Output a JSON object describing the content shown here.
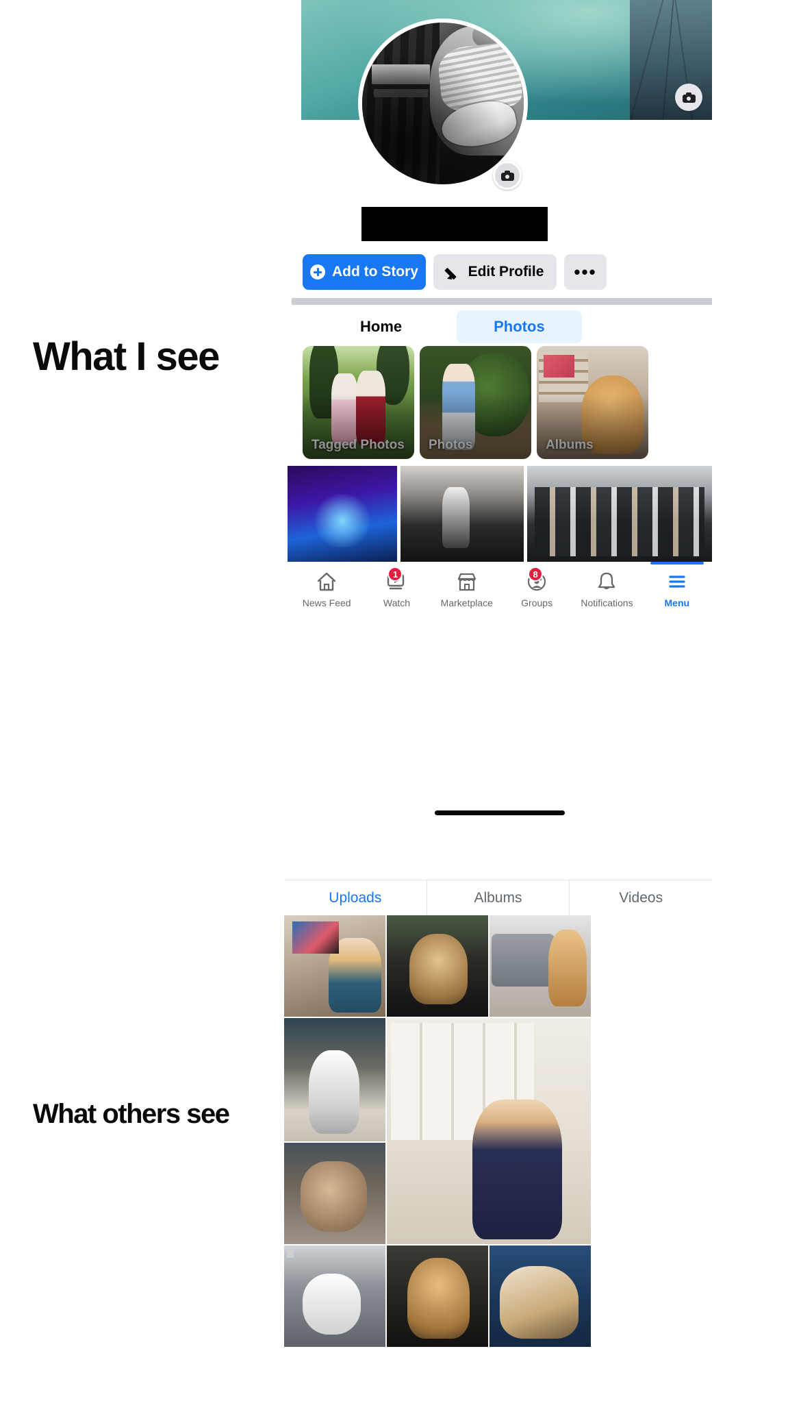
{
  "annotations": {
    "top": "What I see",
    "bottom": "What others see"
  },
  "colors": {
    "accent_blue": "#1877f2",
    "pill_blue_bg": "#e7f3ff",
    "badge_red": "#e41e3f",
    "button_grey": "#e4e6eb",
    "muted_text": "#65676b"
  },
  "profile_screen": {
    "cover_camera_icon": "camera-icon",
    "profile_camera_icon": "camera-icon",
    "name_redacted": "",
    "actions": [
      {
        "id": "add-to-story",
        "label": "Add to Story",
        "icon": "plus-circle-icon",
        "style": "primary"
      },
      {
        "id": "edit-profile",
        "label": "Edit Profile",
        "icon": "pencil-icon",
        "style": "secondary"
      },
      {
        "id": "more-options",
        "label": "•••",
        "icon": "ellipsis-icon",
        "style": "secondary"
      }
    ],
    "tabs": [
      {
        "label": "Home",
        "active": false
      },
      {
        "label": "Photos",
        "active": true
      }
    ],
    "highlight_tiles": [
      {
        "label": "Tagged Photos"
      },
      {
        "label": "Photos"
      },
      {
        "label": "Albums"
      }
    ],
    "bottom_nav": [
      {
        "label": "News Feed",
        "icon": "home-icon",
        "badge": "",
        "active": false
      },
      {
        "label": "Watch",
        "icon": "video-play-icon",
        "badge": "1",
        "active": false
      },
      {
        "label": "Marketplace",
        "icon": "storefront-icon",
        "badge": "",
        "active": false
      },
      {
        "label": "Groups",
        "icon": "groups-icon",
        "badge": "8",
        "active": false
      },
      {
        "label": "Notifications",
        "icon": "bell-icon",
        "badge": "",
        "active": false
      },
      {
        "label": "Menu",
        "icon": "hamburger-menu-icon",
        "badge": "",
        "active": true
      }
    ]
  },
  "photos_screen": {
    "tabs": [
      {
        "label": "Uploads",
        "active": true
      },
      {
        "label": "Albums",
        "active": false
      },
      {
        "label": "Videos",
        "active": false
      }
    ],
    "grid_item_count": 9
  }
}
